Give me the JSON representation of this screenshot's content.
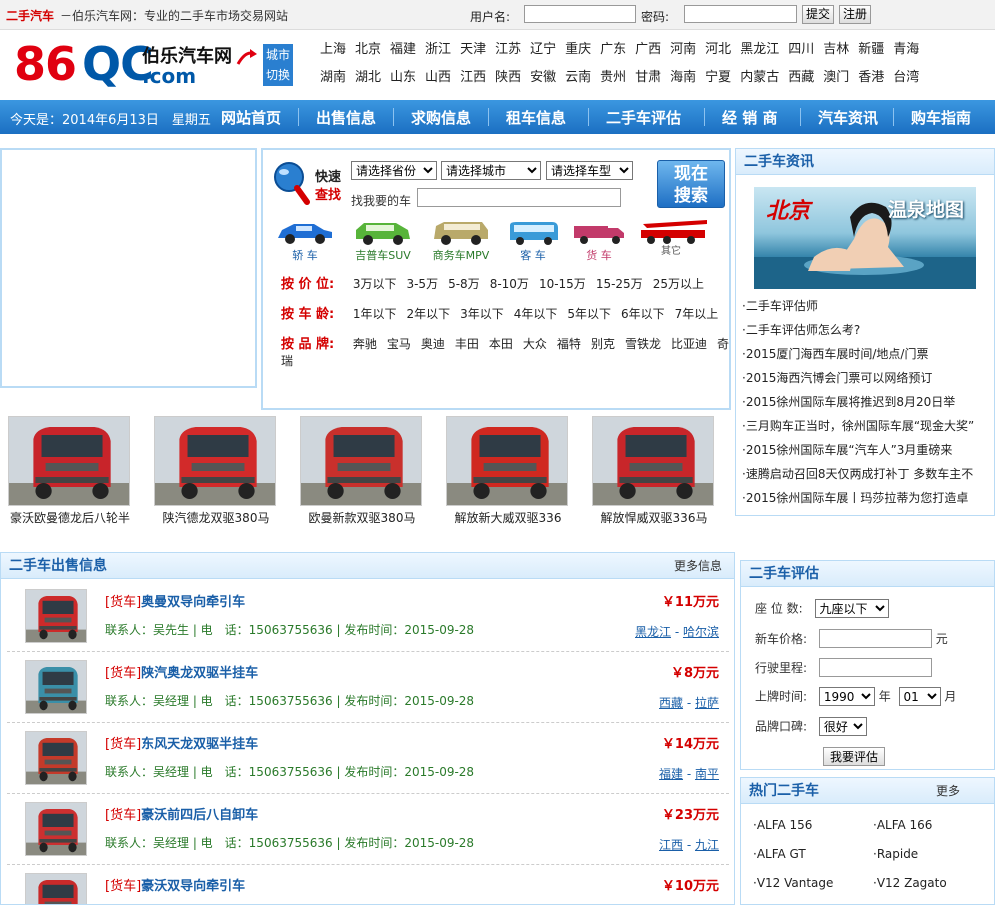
{
  "topbar": {
    "brand": "二手汽车",
    "slogan": "－伯乐汽车网：专业的二手车市场交易网站",
    "username_label": "用户名:",
    "password_label": "密码:",
    "submit_label": "提交",
    "register_label": "注册"
  },
  "logo": {
    "num": "86",
    "qc": "QC",
    "name": "伯乐汽车网",
    "com": ".com"
  },
  "city_switch": {
    "line1": "城市",
    "line2": "切换"
  },
  "cities": {
    "row1": [
      "上海",
      "北京",
      "福建",
      "浙江",
      "天津",
      "江苏",
      "辽宁",
      "重庆",
      "广东",
      "广西",
      "河南",
      "河北",
      "黑龙江",
      "四川",
      "吉林",
      "新疆",
      "青海"
    ],
    "row2": [
      "湖南",
      "湖北",
      "山东",
      "山西",
      "江西",
      "陕西",
      "安徽",
      "云南",
      "贵州",
      "甘肃",
      "海南",
      "宁夏",
      "内蒙古",
      "西藏",
      "澳门",
      "香港",
      "台湾"
    ]
  },
  "nav": {
    "date": "今天是：2014年6月13日　星期五",
    "items": [
      "网站首页",
      "出售信息",
      "求购信息",
      "租车信息",
      "二手车评估",
      "经 销 商",
      "汽车资讯",
      "购车指南"
    ]
  },
  "search": {
    "kuai": "快速",
    "zhao": "查找",
    "province": "请选择省份",
    "city": "请选择城市",
    "type": "请选择车型",
    "find_label": "找我要的车",
    "btn_line1": "现在",
    "btn_line2": "搜索",
    "categories": [
      "轿 车",
      "吉普车SUV",
      "商务车MPV",
      "客 车",
      "货 车",
      "其它"
    ],
    "price_label": "按 价 位:",
    "prices": [
      "3万以下",
      "3-5万",
      "5-8万",
      "8-10万",
      "10-15万",
      "15-25万",
      "25万以上"
    ],
    "age_label": "按 车 龄:",
    "ages": [
      "1年以下",
      "2年以下",
      "3年以下",
      "4年以下",
      "5年以下",
      "6年以下",
      "7年以上"
    ],
    "brand_label": "按 品 牌:",
    "brands": [
      "奔驰",
      "宝马",
      "奥迪",
      "丰田",
      "本田",
      "大众",
      "福特",
      "别克",
      "雪铁龙",
      "比亚迪",
      "奇瑞"
    ]
  },
  "news": {
    "title": "二手车资讯",
    "img_text": "北京",
    "img_text2": "温泉地图",
    "items": [
      "·二手车评估师",
      "·二手车评估师怎么考?",
      "·2015厦门海西车展时间/地点/门票",
      "·2015海西汽博会门票可以网络预订",
      "·2015徐州国际车展将推迟到8月20日举",
      "·三月购车正当时，徐州国际车展“现金大奖”",
      "·2015徐州国际车展“汽车人”3月重磅来",
      "·速腾启动召回8天仅两成打补丁 多数车主不",
      "·2015徐州国际车展丨玛莎拉蒂为您打造卓"
    ]
  },
  "thumbs": [
    "豪沃欧曼德龙后八轮半",
    "陕汽德龙双驱380马",
    "欧曼新款双驱380马",
    "解放新大威双驱336",
    "解放悍威双驱336马"
  ],
  "sell": {
    "title": "二手车出售信息",
    "more": "更多信息",
    "rows": [
      {
        "tag": "[货车]",
        "title": "奥曼双导向牵引车",
        "price": "￥11万元",
        "info": "联系人：吴先生 | 电　话：15063755636 | 发布时间：2015-09-28",
        "prov": "黑龙江",
        "city": "哈尔滨"
      },
      {
        "tag": "[货车]",
        "title": "陕汽奥龙双驱半挂车",
        "price": "￥8万元",
        "info": "联系人：吴经理 | 电　话：15063755636 | 发布时间：2015-09-28",
        "prov": "西藏",
        "city": "拉萨"
      },
      {
        "tag": "[货车]",
        "title": "东风天龙双驱半挂车",
        "price": "￥14万元",
        "info": "联系人：吴经理 | 电　话：15063755636 | 发布时间：2015-09-28",
        "prov": "福建",
        "city": "南平"
      },
      {
        "tag": "[货车]",
        "title": "豪沃前四后八自卸车",
        "price": "￥23万元",
        "info": "联系人：吴经理 | 电　话：15063755636 | 发布时间：2015-09-28",
        "prov": "江西",
        "city": "九江"
      },
      {
        "tag": "[货车]",
        "title": "豪沃双导向牵引车",
        "price": "￥10万元",
        "info": "",
        "prov": "",
        "city": ""
      }
    ]
  },
  "eval": {
    "title": "二手车评估",
    "seats_label": "座 位 数:",
    "seats_value": "九座以下",
    "newprice_label": "新车价格:",
    "yuan": "元",
    "mileage_label": "行驶里程:",
    "date_label": "上牌时间:",
    "year_value": "1990",
    "year_unit": "年",
    "month_value": "01",
    "month_unit": "月",
    "reputation_label": "品牌口碑:",
    "reputation_value": "很好",
    "submit_label": "我要评估"
  },
  "hot": {
    "title": "热门二手车",
    "more": "更多",
    "items": [
      "·ALFA 156",
      "·ALFA 166",
      "·ALFA GT",
      "·Rapide",
      "·V12 Vantage",
      "·V12 Zagato"
    ]
  }
}
